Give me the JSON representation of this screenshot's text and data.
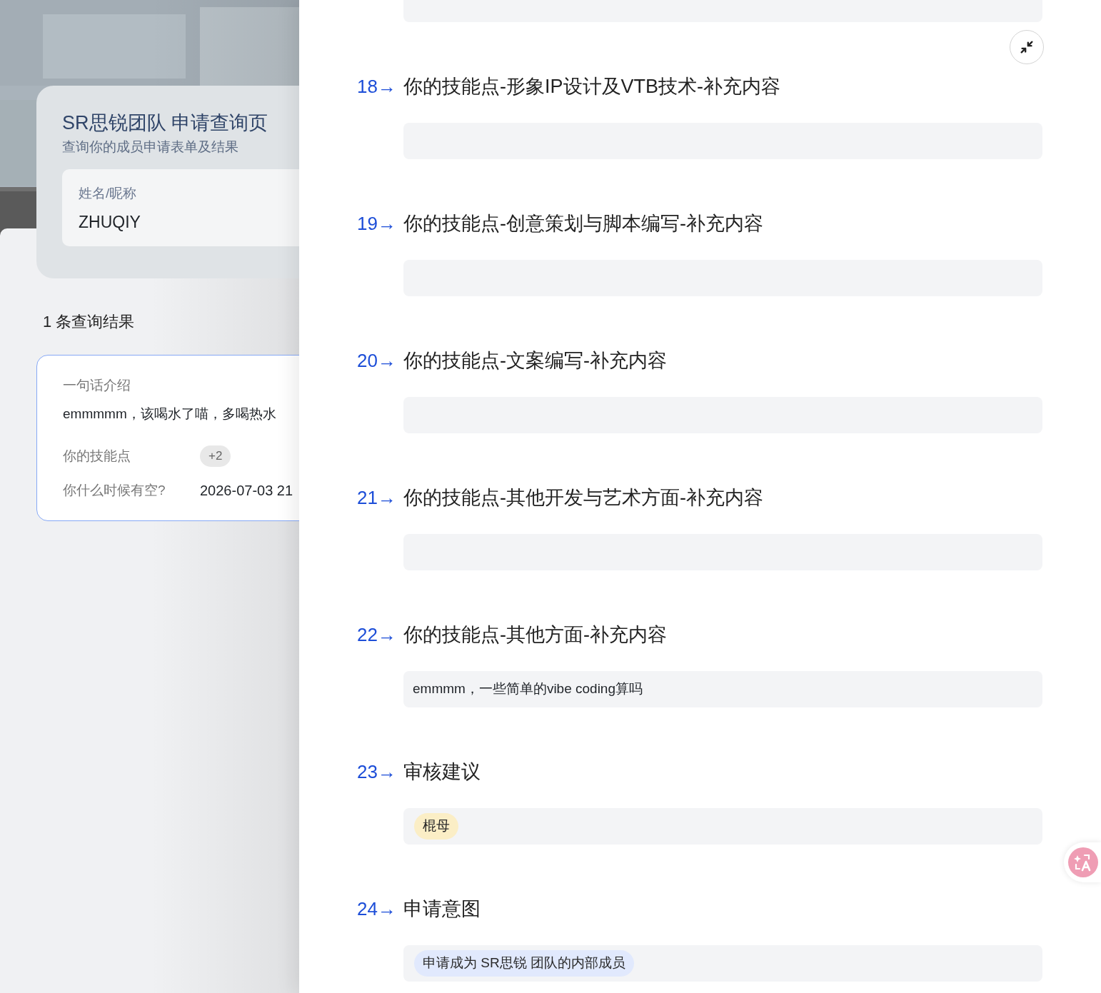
{
  "header": {
    "title": "SR思锐团队 申请查询页",
    "subtitle": "查询你的成员申请表单及结果"
  },
  "search": {
    "label": "姓名/昵称",
    "value": "ZHUQIY"
  },
  "results": {
    "count": "1 条查询结果",
    "card": {
      "fields": [
        {
          "kind": "block",
          "label": "一句话介绍",
          "value": "emmmmm，该喝水了喵，多喝热水"
        },
        {
          "kind": "badge",
          "label": "你的技能点",
          "value": "+2"
        },
        {
          "kind": "inline",
          "label": "你什么时候有空?",
          "value": "2026-07-03 21"
        }
      ]
    }
  },
  "questions": [
    {
      "number": "18→",
      "label": "你的技能点-形象IP设计及VTB技术-补充内容",
      "answer": {
        "kind": "empty"
      }
    },
    {
      "number": "19→",
      "label": "你的技能点-创意策划与脚本编写-补充内容",
      "answer": {
        "kind": "empty"
      }
    },
    {
      "number": "20→",
      "label": "你的技能点-文案编写-补充内容",
      "answer": {
        "kind": "empty"
      }
    },
    {
      "number": "21→",
      "label": "你的技能点-其他开发与艺术方面-补充内容",
      "answer": {
        "kind": "empty"
      }
    },
    {
      "number": "22→",
      "label": "你的技能点-其他方面-补充内容",
      "answer": {
        "kind": "text",
        "text": "emmmm，一些简单的vibe coding算吗"
      }
    },
    {
      "number": "23→",
      "label": "审核建议",
      "answer": {
        "kind": "tag",
        "text": "棍母",
        "color": "#fbeec6"
      }
    },
    {
      "number": "24→",
      "label": "申请意图",
      "answer": {
        "kind": "tag",
        "text": "申请成为 SR思锐 团队的内部成员",
        "color": "#e1e9fd"
      }
    }
  ]
}
